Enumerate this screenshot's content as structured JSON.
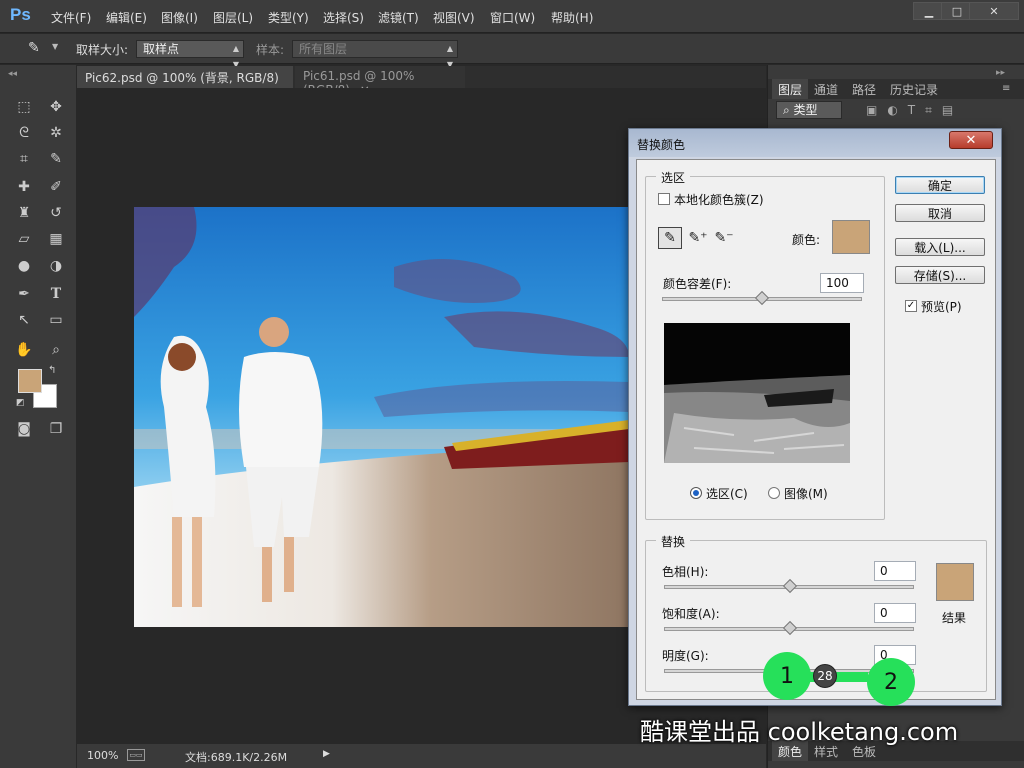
{
  "app": {
    "logo": "Ps"
  },
  "menu": [
    "文件(F)",
    "编辑(E)",
    "图像(I)",
    "图层(L)",
    "类型(Y)",
    "选择(S)",
    "滤镜(T)",
    "视图(V)",
    "窗口(W)",
    "帮助(H)"
  ],
  "window_controls": {
    "minimize": "▁",
    "maximize": "□",
    "close": "✕"
  },
  "options_bar": {
    "sample_size_label": "取样大小:",
    "sample_size_value": "取样点",
    "sample_label": "样本:",
    "sample_value": "所有图层"
  },
  "doc_tabs": [
    {
      "label": "Pic62.psd @ 100% (背景, RGB/8) *",
      "close": "×"
    },
    {
      "label": "Pic61.psd @ 100%(RGB/8)",
      "close": "×"
    }
  ],
  "status": {
    "zoom": "100%",
    "doc_info": "文档:689.1K/2.26M"
  },
  "right_panel": {
    "tabs": [
      "图层",
      "通道",
      "路径",
      "历史记录"
    ],
    "filter_label": "类型",
    "bottom_tabs": [
      "颜色",
      "样式",
      "色板"
    ]
  },
  "dialog": {
    "title": "替换颜色",
    "close": "✕",
    "selection_group": "选区",
    "localized_clusters": "本地化颜色簇(Z)",
    "color_label": "颜色:",
    "fuzziness_label": "颜色容差(F):",
    "fuzziness_value": "100",
    "radio_selection": "选区(C)",
    "radio_image": "图像(M)",
    "replacement_group": "替换",
    "hue_label": "色相(H):",
    "hue_value": "0",
    "saturation_label": "饱和度(A):",
    "saturation_value": "0",
    "lightness_label": "明度(G):",
    "lightness_value": "0",
    "result_label": "结果",
    "ok": "确定",
    "cancel": "取消",
    "load": "载入(L)...",
    "save": "存储(S)...",
    "preview": "预览(P)",
    "preview_checked": true,
    "localized_checked": false
  },
  "colors": {
    "sample_color": "#c9a478",
    "result_color": "#c9a478",
    "foreground": "#c9a478",
    "background": "#ffffff"
  },
  "tutorial": {
    "step1": "1",
    "step_counter": "28",
    "step2": "2"
  },
  "watermark": "酷课堂出品 coolketang.com"
}
